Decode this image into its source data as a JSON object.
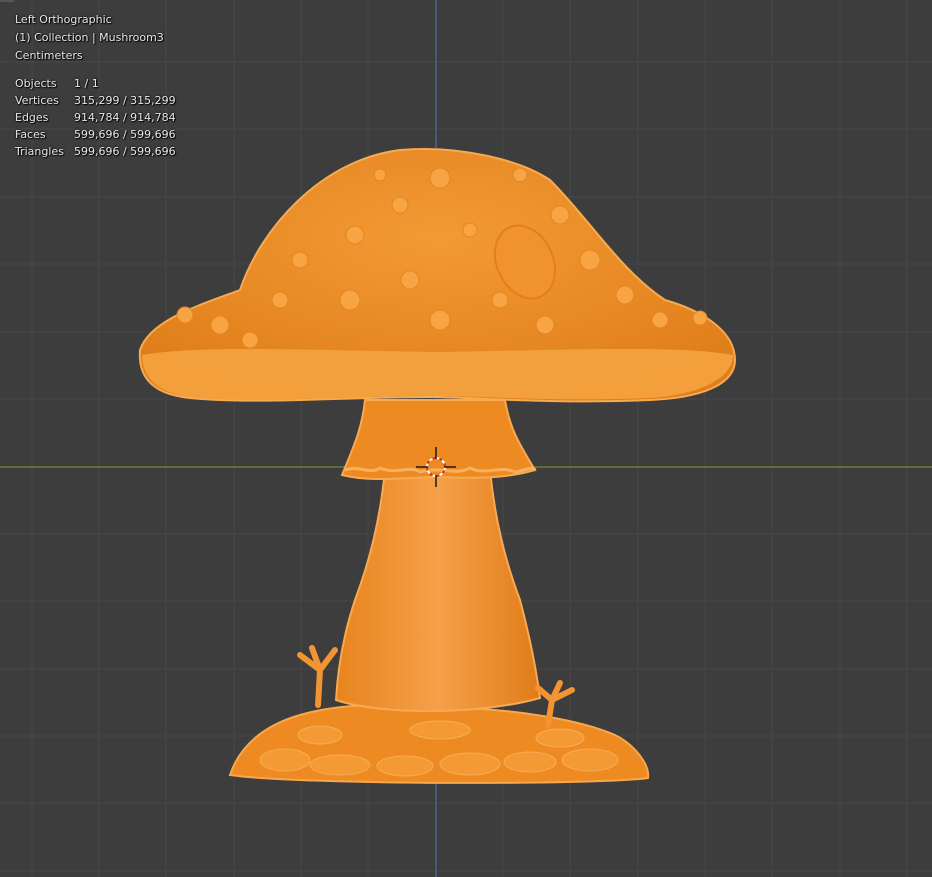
{
  "viewport": {
    "view_name": "Left Orthographic",
    "collection_line": "(1) Collection | Mushroom3",
    "units": "Centimeters",
    "stats": [
      {
        "label": "Objects",
        "value": "1 / 1"
      },
      {
        "label": "Vertices",
        "value": "315,299 / 315,299"
      },
      {
        "label": "Edges",
        "value": "914,784 / 914,784"
      },
      {
        "label": "Faces",
        "value": "599,696 / 599,696"
      },
      {
        "label": "Triangles",
        "value": "599,696 / 599,696"
      }
    ]
  },
  "colors": {
    "background": "#3d3d3d",
    "grid_line": "#4a4a4a",
    "axis_green": "#6e8a3a",
    "axis_blue": "#4a6fa0",
    "selection_orange": "#f5a03c",
    "mesh_fill": "#f08c22"
  },
  "icons": [
    "3d-cursor-icon",
    "mushroom-mesh"
  ]
}
